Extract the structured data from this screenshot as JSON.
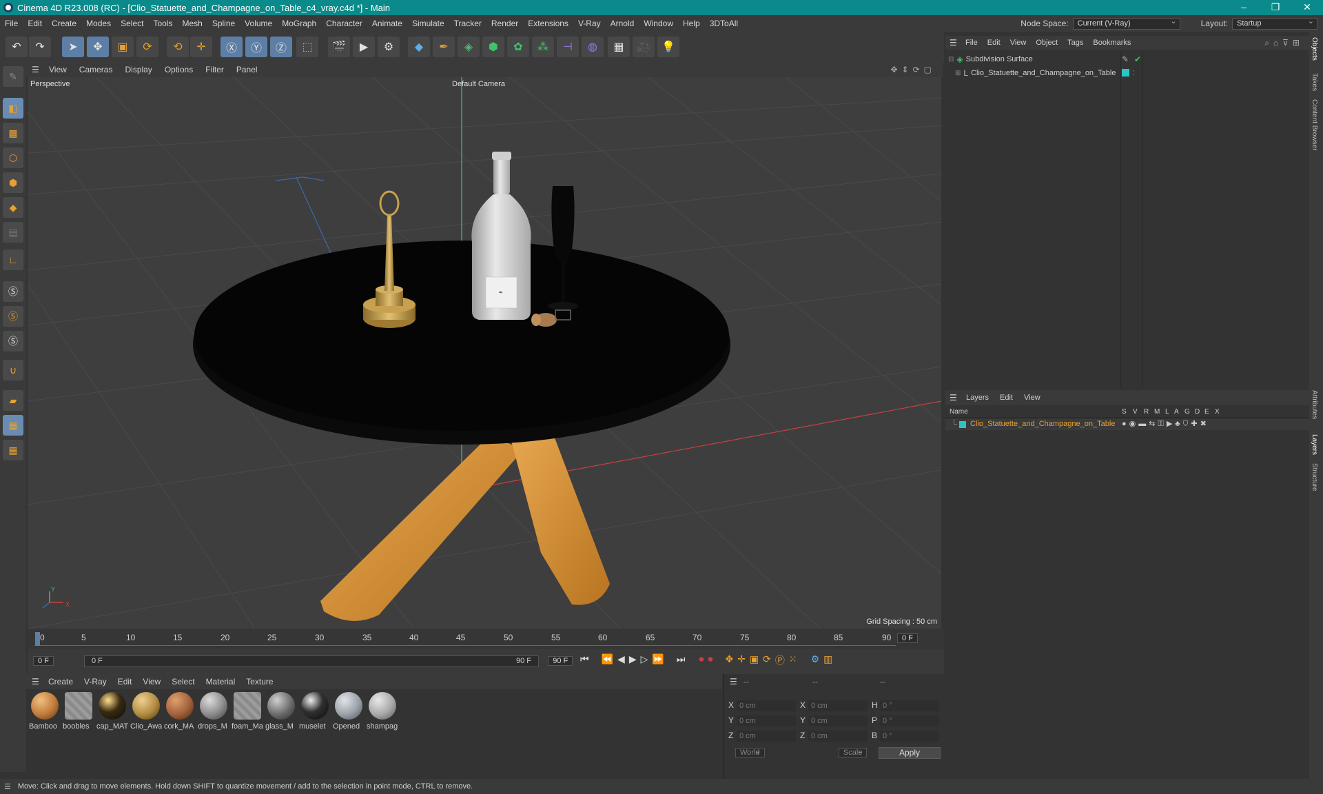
{
  "window": {
    "title": "Cinema 4D R23.008 (RC) - [Clio_Statuette_and_Champagne_on_Table_c4_vray.c4d *] - Main"
  },
  "menubar": {
    "items": [
      "File",
      "Edit",
      "Create",
      "Modes",
      "Select",
      "Tools",
      "Mesh",
      "Spline",
      "Volume",
      "MoGraph",
      "Character",
      "Animate",
      "Simulate",
      "Tracker",
      "Render",
      "Extensions",
      "V-Ray",
      "Arnold",
      "Window",
      "Help",
      "3DToAll"
    ],
    "node_space_label": "Node Space:",
    "node_space_value": "Current (V-Ray)",
    "layout_label": "Layout:",
    "layout_value": "Startup"
  },
  "viewport": {
    "menu": [
      "View",
      "Cameras",
      "Display",
      "Options",
      "Filter",
      "Panel"
    ],
    "view_name": "Perspective",
    "camera_name": "Default Camera",
    "grid_spacing": "Grid Spacing : 50 cm",
    "axis_y": "Y",
    "axis_x": "X"
  },
  "timeline": {
    "ticks": [
      "0",
      "5",
      "10",
      "15",
      "20",
      "25",
      "30",
      "35",
      "40",
      "45",
      "50",
      "55",
      "60",
      "65",
      "70",
      "75",
      "80",
      "85",
      "90"
    ],
    "current_frame_right": "0 F",
    "start_frame": "0 F",
    "range_start": "0 F",
    "range_end": "90 F",
    "end_frame": "90 F"
  },
  "material_manager": {
    "menu": [
      "Create",
      "V-Ray",
      "Edit",
      "View",
      "Select",
      "Material",
      "Texture"
    ],
    "materials": [
      {
        "label": "Bamboo",
        "color": "#c07a3a"
      },
      {
        "label": "boobles",
        "color": "#8a8a8a"
      },
      {
        "label": "cap_MAT",
        "color": "#1a1a1a"
      },
      {
        "label": "Clio_Awa",
        "color": "#b08a40"
      },
      {
        "label": "cork_MA",
        "color": "#a0603a"
      },
      {
        "label": "drops_M",
        "color": "#9a9a9a"
      },
      {
        "label": "foam_Ma",
        "color": "#8a8a8a"
      },
      {
        "label": "glass_M",
        "color": "#7a7a7a"
      },
      {
        "label": "muselet",
        "color": "#303030"
      },
      {
        "label": "Opened",
        "color": "#9aa0a8"
      },
      {
        "label": "shampag",
        "color": "#a8a8a8"
      }
    ]
  },
  "coords": {
    "header": [
      "--",
      "--",
      "--"
    ],
    "rows": [
      {
        "a": "X",
        "av": "0 cm",
        "b": "X",
        "bv": "0 cm",
        "c": "H",
        "cv": "0 °"
      },
      {
        "a": "Y",
        "av": "0 cm",
        "b": "Y",
        "bv": "0 cm",
        "c": "P",
        "cv": "0 °"
      },
      {
        "a": "Z",
        "av": "0 cm",
        "b": "Z",
        "bv": "0 cm",
        "c": "B",
        "cv": "0 °"
      }
    ],
    "mode1": "World",
    "mode2": "Scale",
    "apply": "Apply"
  },
  "object_manager": {
    "menu": [
      "File",
      "Edit",
      "View",
      "Object",
      "Tags",
      "Bookmarks"
    ],
    "objects": [
      {
        "name": "Subdivision Surface"
      },
      {
        "name": "Clio_Statuette_and_Champagne_on_Table"
      }
    ]
  },
  "layer_manager": {
    "menu": [
      "Layers",
      "Edit",
      "View"
    ],
    "columns": [
      "Name",
      "S",
      "V",
      "R",
      "M",
      "L",
      "A",
      "G",
      "D",
      "E",
      "X"
    ],
    "layers": [
      {
        "name": "Clio_Statuette_and_Champagne_on_Table",
        "color": "#2bc4c4"
      }
    ]
  },
  "side_tabs": [
    "Objects",
    "Takes",
    "Content Browser",
    "Attributes",
    "Layers",
    "Structure"
  ],
  "status": "Move: Click and drag to move elements. Hold down SHIFT to quantize movement / add to the selection in point mode, CTRL to remove.",
  "colors": {
    "accent": "#0a8a8a",
    "highlight": "#5d7fa6",
    "layer_name": "#e8a030"
  }
}
